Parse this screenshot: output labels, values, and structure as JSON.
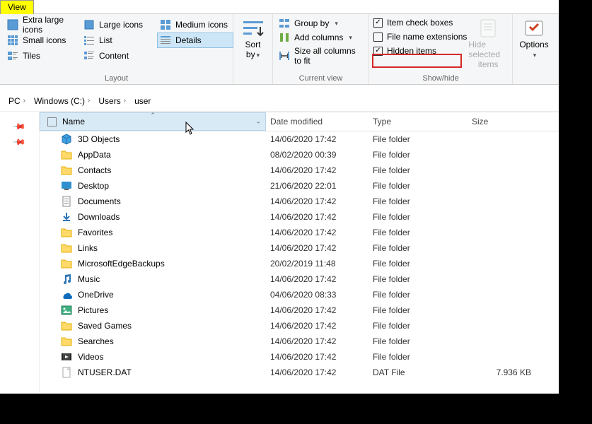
{
  "tab": {
    "view": "View"
  },
  "ribbon": {
    "layout": {
      "label": "Layout",
      "items": [
        "Extra large icons",
        "Large icons",
        "Medium icons",
        "Small icons",
        "List",
        "Details",
        "Tiles",
        "Content"
      ],
      "selected_index": 5
    },
    "sort": {
      "label": "Sort by"
    },
    "current_view": {
      "label": "Current view",
      "group_by": "Group by",
      "add_columns": "Add columns",
      "size_all": "Size all columns to fit"
    },
    "show_hide": {
      "label": "Show/hide",
      "item_check": "Item check boxes",
      "file_ext": "File name extensions",
      "hidden": "Hidden items",
      "hide_selected_l1": "Hide selected",
      "hide_selected_l2": "items",
      "item_check_checked": true,
      "file_ext_checked": false,
      "hidden_checked": true
    },
    "options": {
      "label": "Options"
    }
  },
  "breadcrumb": [
    "PC",
    "Windows (C:)",
    "Users",
    "user"
  ],
  "columns": {
    "name": "Name",
    "date": "Date modified",
    "type": "Type",
    "size": "Size"
  },
  "rows": [
    {
      "name": "3D Objects",
      "date": "14/06/2020 17:42",
      "type": "File folder",
      "size": "",
      "icon": "3d"
    },
    {
      "name": "AppData",
      "date": "08/02/2020 00:39",
      "type": "File folder",
      "size": "",
      "icon": "folder"
    },
    {
      "name": "Contacts",
      "date": "14/06/2020 17:42",
      "type": "File folder",
      "size": "",
      "icon": "folder"
    },
    {
      "name": "Desktop",
      "date": "21/06/2020 22:01",
      "type": "File folder",
      "size": "",
      "icon": "desktop"
    },
    {
      "name": "Documents",
      "date": "14/06/2020 17:42",
      "type": "File folder",
      "size": "",
      "icon": "docs"
    },
    {
      "name": "Downloads",
      "date": "14/06/2020 17:42",
      "type": "File folder",
      "size": "",
      "icon": "downloads"
    },
    {
      "name": "Favorites",
      "date": "14/06/2020 17:42",
      "type": "File folder",
      "size": "",
      "icon": "folder"
    },
    {
      "name": "Links",
      "date": "14/06/2020 17:42",
      "type": "File folder",
      "size": "",
      "icon": "folder"
    },
    {
      "name": "MicrosoftEdgeBackups",
      "date": "20/02/2019 11:48",
      "type": "File folder",
      "size": "",
      "icon": "folder"
    },
    {
      "name": "Music",
      "date": "14/06/2020 17:42",
      "type": "File folder",
      "size": "",
      "icon": "music"
    },
    {
      "name": "OneDrive",
      "date": "04/06/2020 08:33",
      "type": "File folder",
      "size": "",
      "icon": "onedrive"
    },
    {
      "name": "Pictures",
      "date": "14/06/2020 17:42",
      "type": "File folder",
      "size": "",
      "icon": "pictures"
    },
    {
      "name": "Saved Games",
      "date": "14/06/2020 17:42",
      "type": "File folder",
      "size": "",
      "icon": "folder"
    },
    {
      "name": "Searches",
      "date": "14/06/2020 17:42",
      "type": "File folder",
      "size": "",
      "icon": "folder"
    },
    {
      "name": "Videos",
      "date": "14/06/2020 17:42",
      "type": "File folder",
      "size": "",
      "icon": "videos"
    },
    {
      "name": "NTUSER.DAT",
      "date": "14/06/2020 17:42",
      "type": "DAT File",
      "size": "7.936 KB",
      "icon": "file"
    }
  ]
}
